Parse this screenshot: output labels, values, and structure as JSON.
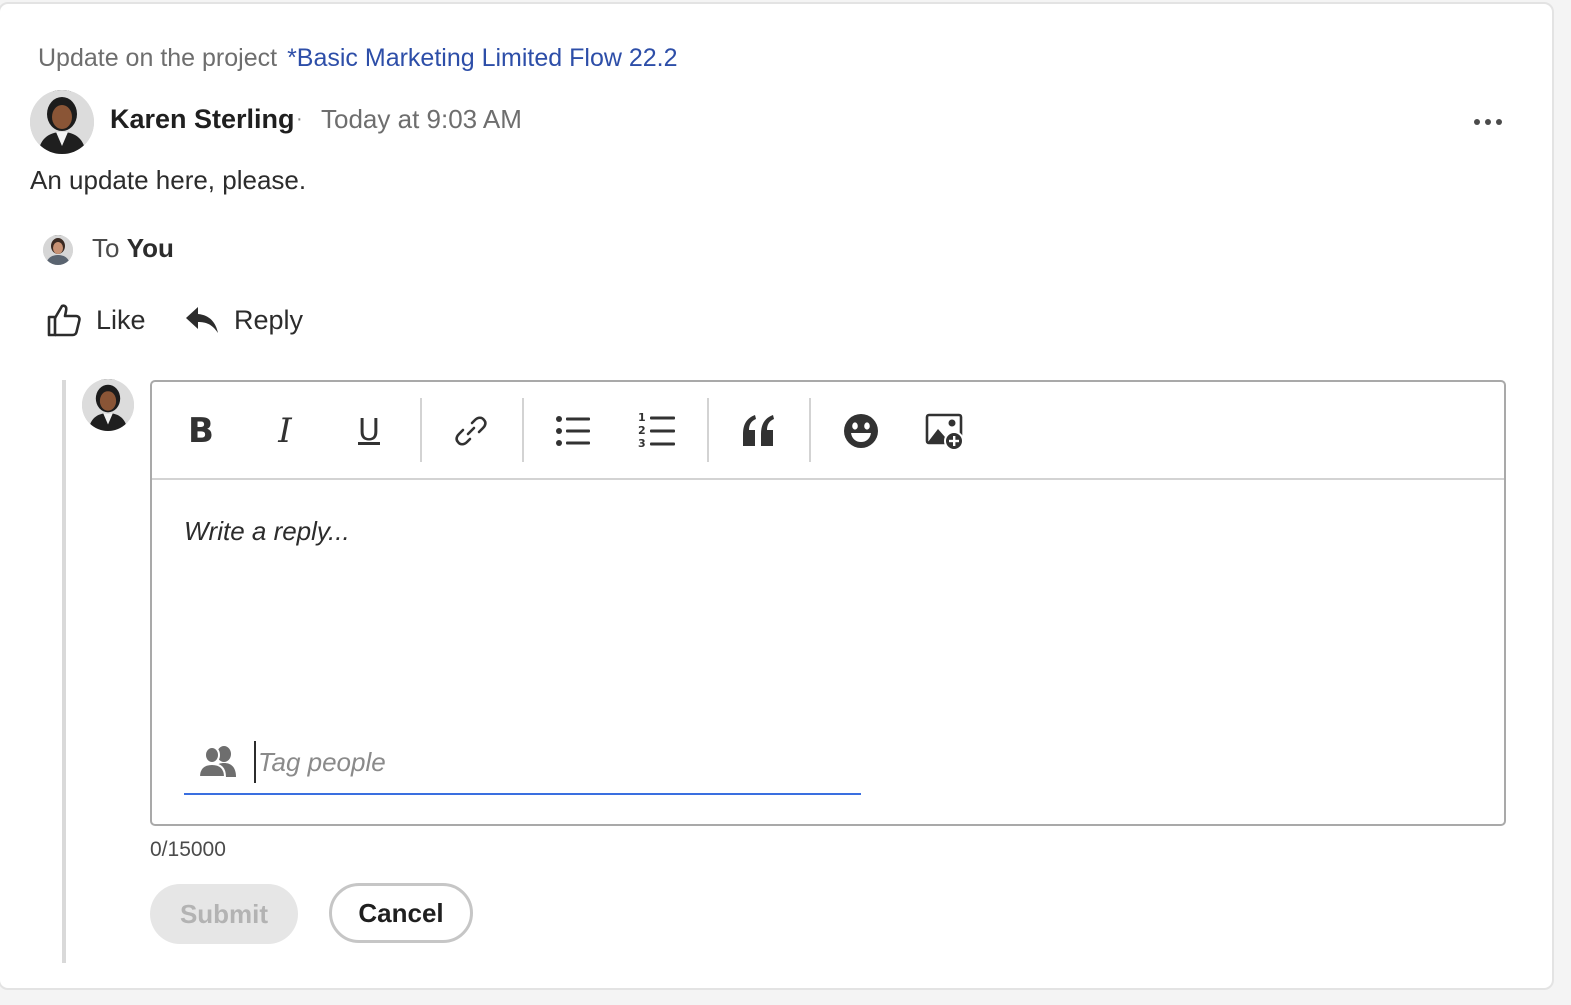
{
  "post": {
    "context_prefix": "Update on the project",
    "project_link": "*Basic Marketing Limited Flow 22.2",
    "author": "Karen Sterling",
    "separator": "·",
    "timestamp": "Today at 9:03 AM",
    "message": "An update here, please.",
    "to_label": "To",
    "to_target": "You",
    "more_icon": "more-horizontal-icon"
  },
  "actions": {
    "like_label": "Like",
    "reply_label": "Reply"
  },
  "editor": {
    "toolbar": [
      {
        "name": "bold",
        "icon": "bold-icon"
      },
      {
        "name": "italic",
        "icon": "italic-icon"
      },
      {
        "name": "underline",
        "icon": "underline-icon"
      },
      {
        "name": "link",
        "icon": "link-icon"
      },
      {
        "name": "bulleted-list",
        "icon": "bulleted-list-icon"
      },
      {
        "name": "numbered-list",
        "icon": "numbered-list-icon"
      },
      {
        "name": "quote",
        "icon": "quote-icon"
      },
      {
        "name": "emoji",
        "icon": "emoji-icon"
      },
      {
        "name": "insert-image",
        "icon": "image-add-icon"
      }
    ],
    "bold_glyph": "B",
    "italic_glyph": "I",
    "underline_glyph": "U",
    "quote_glyph": "“",
    "placeholder": "Write a reply...",
    "tag_placeholder": "Tag people",
    "tag_value": ""
  },
  "form": {
    "counter": "0/15000",
    "submit_label": "Submit",
    "cancel_label": "Cancel"
  },
  "colors": {
    "link": "#2d4ea8",
    "focus_underline": "#3a6fe0",
    "disabled_button_bg": "#e6e6e6",
    "disabled_button_text": "#b3b3b3"
  }
}
